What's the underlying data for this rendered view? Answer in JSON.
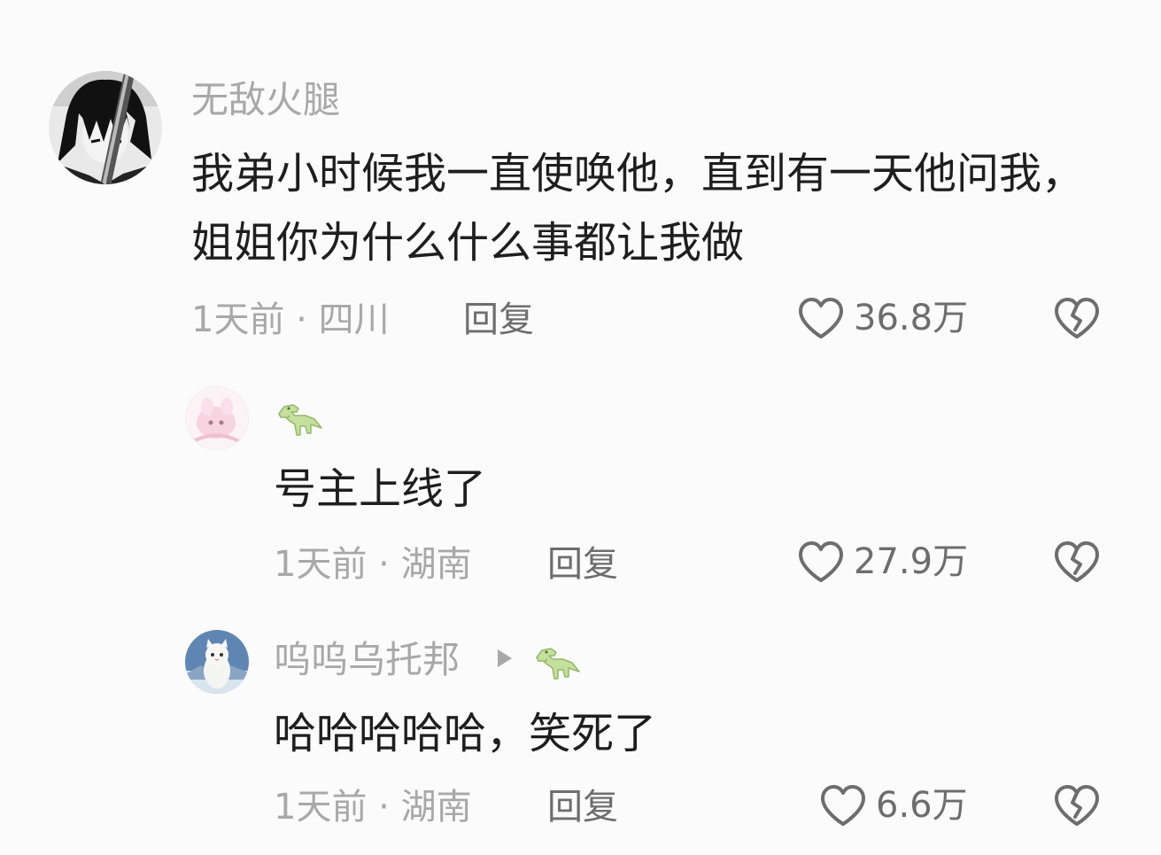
{
  "comments": [
    {
      "username": "无敌火腿",
      "text_lines": [
        "我弟小时候我一直使唤他，直到有一天他问我，",
        "姐姐你为什么什么事都让我做"
      ],
      "time": "1天前",
      "location": "四川",
      "reply_label": "回复",
      "likes": "36.8万"
    },
    {
      "username": "",
      "text_lines": [
        "号主上线了"
      ],
      "time": "1天前",
      "location": "湖南",
      "reply_label": "回复",
      "likes": "27.9万"
    },
    {
      "username": "呜呜乌托邦",
      "text_lines": [
        "哈哈哈哈哈，笑死了"
      ],
      "time": "1天前",
      "location": "湖南",
      "reply_label": "回复",
      "likes": "6.6万"
    }
  ],
  "meta_separator": " · ",
  "icons": {
    "like": "heart-outline-icon",
    "dislike": "broken-heart-icon",
    "badge": "dinosaur-icon",
    "reply_to": "triangle-arrow-icon"
  },
  "colors": {
    "background": "#fbfbfb",
    "text": "#1e1e1e",
    "muted": "#a8a8a8",
    "icon": "#6d6d6d",
    "dino": "#b9d98c"
  }
}
